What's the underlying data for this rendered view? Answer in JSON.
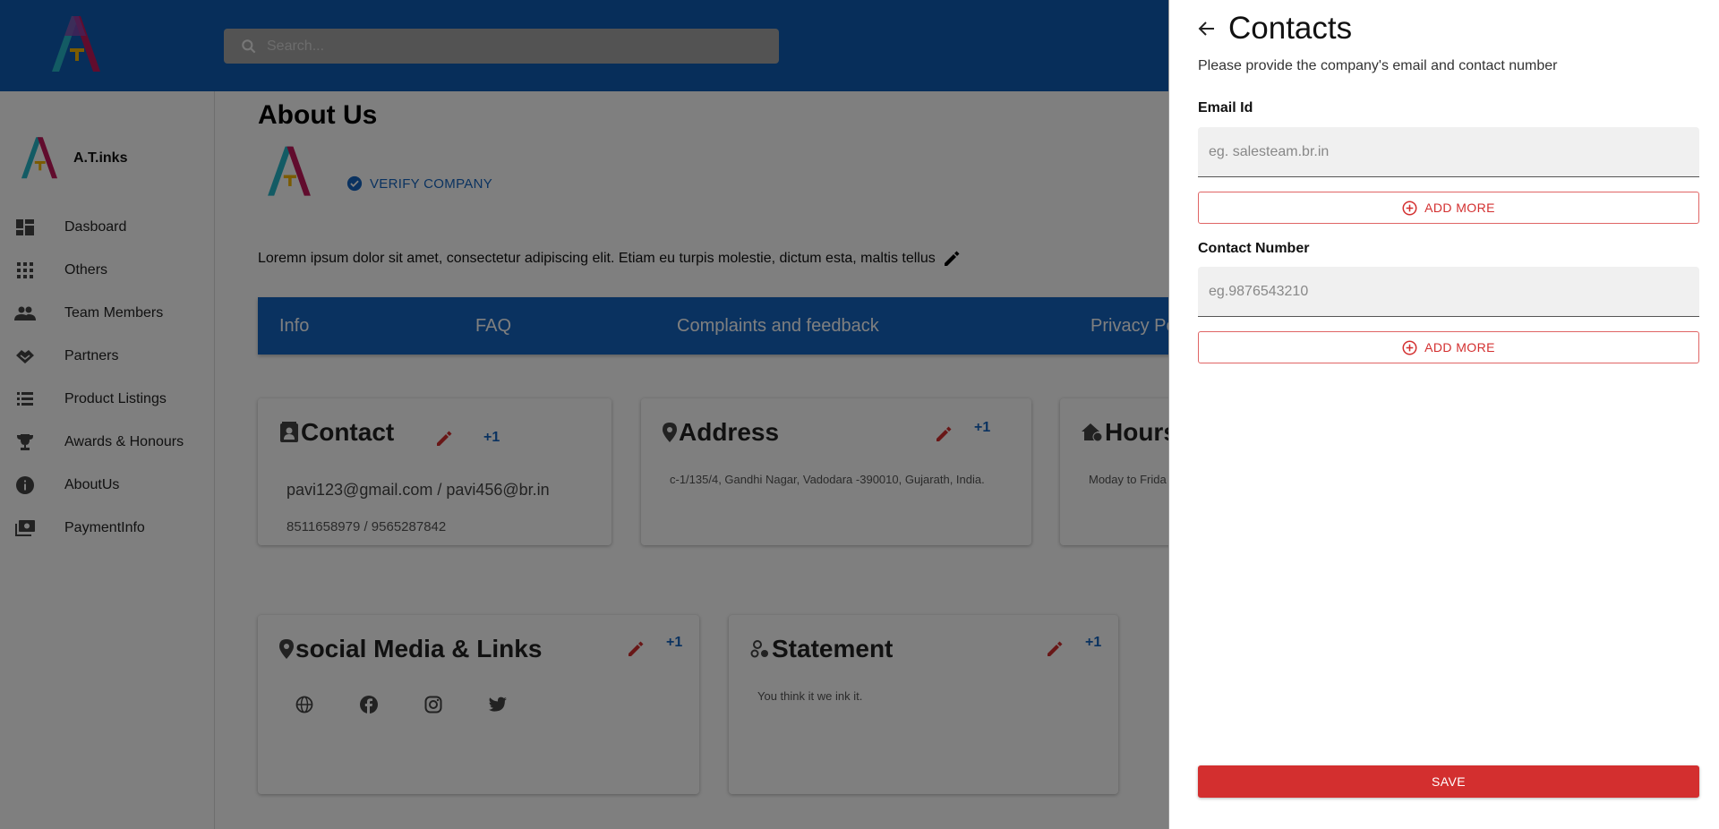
{
  "header": {
    "logo_text": "A.T INKS",
    "search": {
      "placeholder": "Search...",
      "value": ""
    }
  },
  "sidebar": {
    "brand_name": "A.T.inks",
    "items": [
      {
        "label": "Dasboard",
        "icon": "dashboard-icon"
      },
      {
        "label": "Others",
        "icon": "apps-grid-icon"
      },
      {
        "label": "Team Members",
        "icon": "people-icon"
      },
      {
        "label": "Partners",
        "icon": "handshake-icon"
      },
      {
        "label": "Product Listings",
        "icon": "list-icon"
      },
      {
        "label": "Awards & Honours",
        "icon": "trophy-icon"
      },
      {
        "label": "AboutUs",
        "icon": "info-icon"
      },
      {
        "label": "PaymentInfo",
        "icon": "payment-icon"
      }
    ]
  },
  "main": {
    "title": "About Us",
    "verify_label": "VERIFY COMPANY",
    "description": "Loremn ipsum dolor sit amet, consectetur adipiscing elit. Etiam eu turpis molestie, dictum esta, maltis tellus",
    "tabs": [
      "Info",
      "FAQ",
      "Complaints and feedback",
      "Privacy Policy"
    ],
    "cards": {
      "contact": {
        "title": "Contact",
        "plus": "+1",
        "emails": "pavi123@gmail.com / pavi456@br.in",
        "phones": "8511658979 / 9565287842"
      },
      "address": {
        "title": "Address",
        "plus": "+1",
        "text": "c-1/135/4, Gandhi Nagar, Vadodara -390010, Gujarath, India."
      },
      "hours": {
        "title": "Hours",
        "text": "Moday to Frida"
      },
      "social": {
        "title": "social Media & Links",
        "plus": "+1",
        "icons": [
          "globe-icon",
          "facebook-icon",
          "instagram-icon",
          "twitter-icon"
        ]
      },
      "statement": {
        "title": "Statement",
        "plus": "+1",
        "text": "You think it we ink it."
      }
    }
  },
  "drawer": {
    "title": "Contacts",
    "subtitle": "Please provide the company's email and contact number",
    "email": {
      "label": "Email Id",
      "placeholder": "eg. salesteam.br.in",
      "value": ""
    },
    "phone": {
      "label": "Contact Number",
      "placeholder": "eg.9876543210",
      "value": ""
    },
    "add_more_label": "ADD MORE",
    "save_label": "SAVE"
  },
  "colors": {
    "primary_blue": "#1565c0",
    "topbar_blue": "#0f5db5",
    "accent_red": "#d32f2f"
  }
}
